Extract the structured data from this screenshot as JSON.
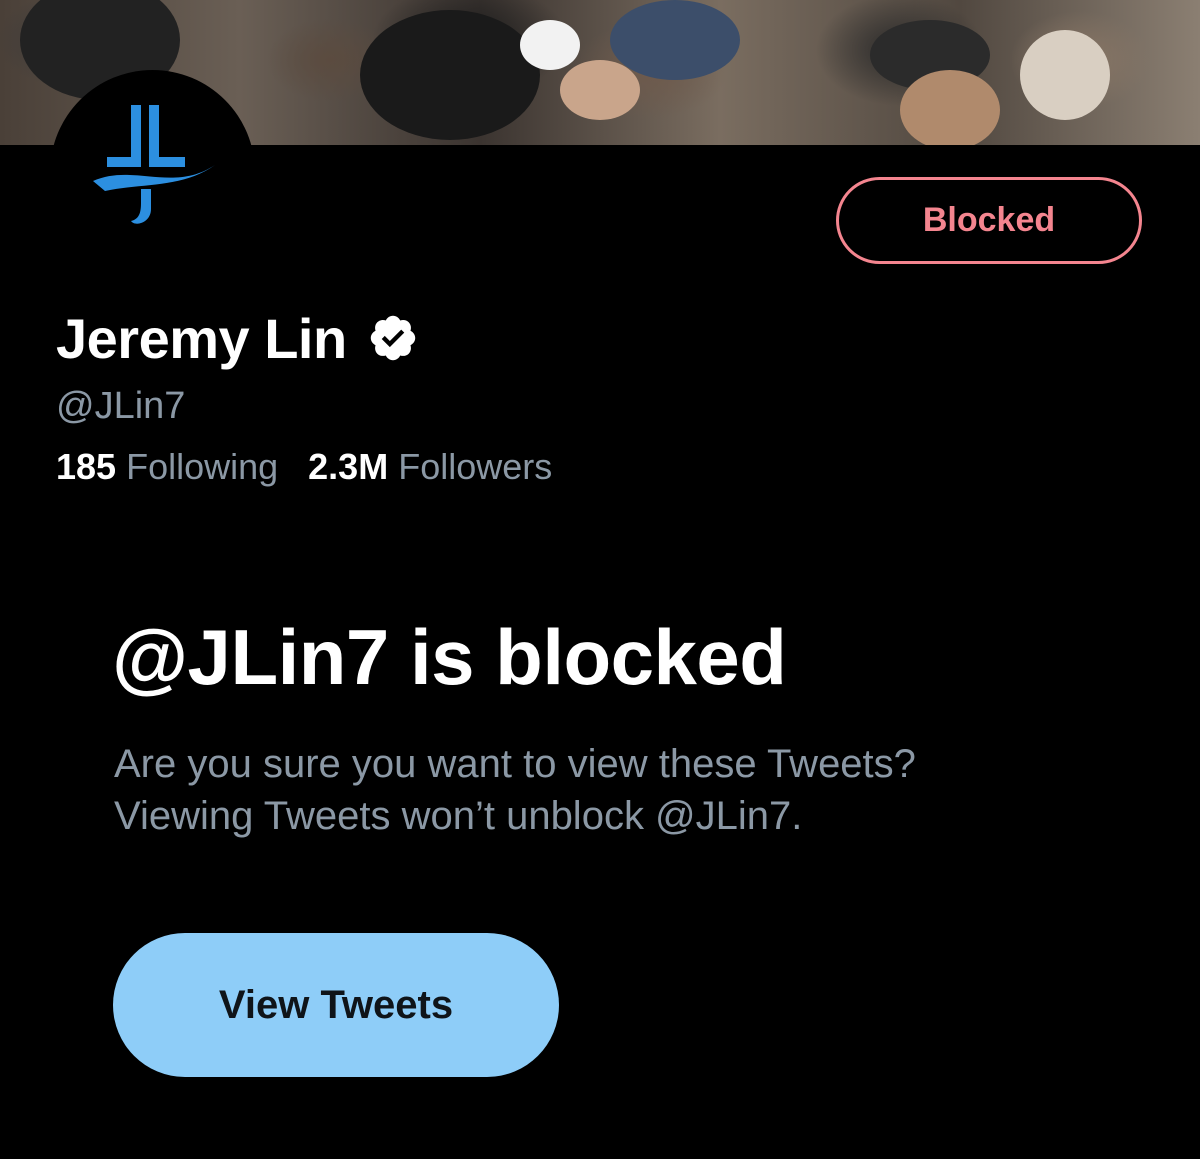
{
  "profile": {
    "banner_alt": "crowd-of-press-photographers",
    "avatar_logo": "JL-logo",
    "display_name": "Jeremy Lin",
    "verified_icon": "verified-badge-icon",
    "handle": "@JLin7",
    "following_count": "185",
    "following_label": "Following",
    "followers_count": "2.3M",
    "followers_label": "Followers"
  },
  "actions": {
    "blocked_label": "Blocked",
    "blocked_color": "#f4858f"
  },
  "blocked_notice": {
    "title": "@JLin7 is blocked",
    "description_line1": "Are you sure you want to view these Tweets?",
    "description_line2": "Viewing Tweets won’t unblock @JLin7.",
    "view_button_label": "View Tweets",
    "view_button_color": "#8ecdf8"
  }
}
